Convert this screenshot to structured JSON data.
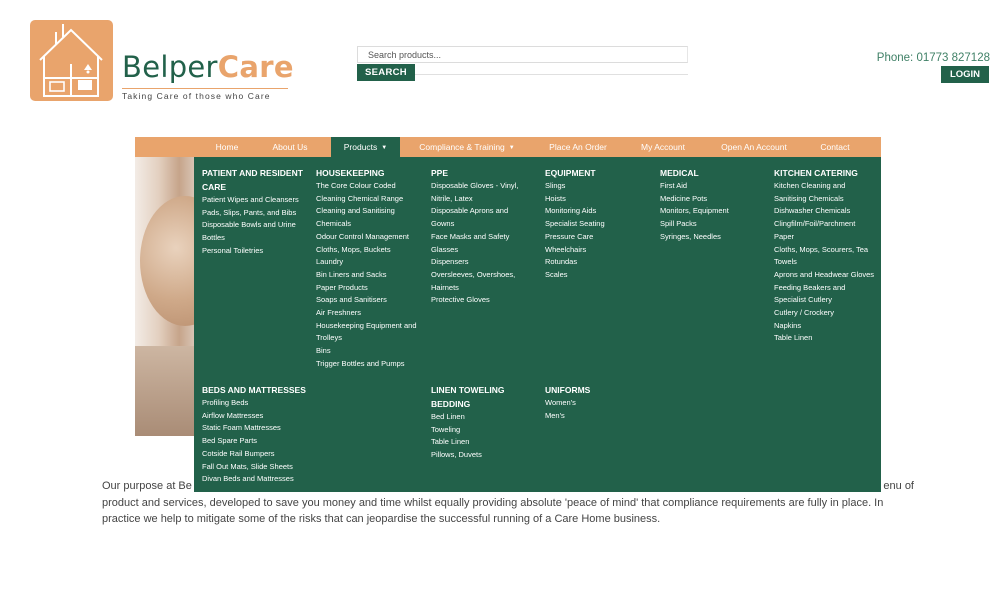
{
  "brand": {
    "name_part1": "Belper",
    "name_part2": "Care",
    "tagline": "Taking Care of those who Care"
  },
  "search": {
    "placeholder": "Search products...",
    "button": "SEARCH"
  },
  "header": {
    "phone": "Phone: 01773 827128",
    "login": "LOGIN"
  },
  "nav": {
    "items": [
      "Home",
      "About Us",
      "Products",
      "Compliance & Training",
      "Place An Order",
      "My Account",
      "Open An Account",
      "Contact"
    ],
    "active": "Products"
  },
  "menu": {
    "patient": {
      "title": "PATIENT AND RESIDENT CARE",
      "items": [
        "Patient Wipes and Cleansers",
        "Pads, Slips, Pants, and Bibs",
        "Disposable Bowls and Urine Bottles",
        "Personal Toiletries"
      ]
    },
    "housekeeping": {
      "title": "HOUSEKEEPING",
      "items": [
        "The Core Colour Coded Cleaning Chemical Range",
        "Cleaning and Sanitising Chemicals",
        "Odour Control Management",
        "Cloths, Mops, Buckets",
        "Laundry",
        "Bin Liners and Sacks",
        "Paper Products",
        "Soaps and Sanitisers",
        "Air Freshners",
        "Housekeeping Equipment and Trolleys",
        "Bins",
        "Trigger Bottles and Pumps"
      ]
    },
    "ppe": {
      "title": "PPE",
      "items": [
        "Disposable Gloves - Vinyl, Nitrile, Latex",
        "Disposable Aprons and Gowns",
        "Face Masks and Safety Glasses",
        "Dispensers",
        "Oversleeves, Overshoes, Hairnets",
        "Protective Gloves"
      ]
    },
    "equipment": {
      "title": "EQUIPMENT",
      "items": [
        "Slings",
        "Hoists",
        "Monitoring Aids",
        "Specialist Seating",
        "Pressure Care",
        "Wheelchairs",
        "Rotundas",
        "Scales"
      ]
    },
    "medical": {
      "title": "MEDICAL",
      "items": [
        "First Aid",
        "Medicine Pots",
        "Monitors, Equipment",
        "Spill Packs",
        "Syringes, Needles"
      ]
    },
    "kitchen": {
      "title": "KITCHEN CATERING",
      "items": [
        "Kitchen Cleaning and Sanitising Chemicals",
        "Dishwasher Chemicals",
        "Clingfilm/Foil/Parchment Paper",
        "Cloths, Mops, Scourers, Tea Towels",
        "Aprons and Headwear Gloves",
        "Feeding Beakers and Specialist Cutlery",
        "Cutlery / Crockery",
        "Napkins",
        "Table Linen"
      ]
    },
    "beds": {
      "title": "BEDS AND MATTRESSES",
      "items": [
        "Profiling Beds",
        "Airflow Mattresses",
        "Static Foam Mattresses",
        "Bed Spare Parts",
        "Cotside Rail Bumpers",
        "Fall Out Mats, Slide Sheets",
        "Divan Beds and Mattresses"
      ]
    },
    "linen": {
      "title": "LINEN TOWELING BEDDING",
      "items": [
        "Bed Linen",
        "Toweling",
        "Table Linen",
        "Pillows, Duvets"
      ]
    },
    "uniforms": {
      "title": "UNIFORMS",
      "items": [
        "Women's",
        "Men's"
      ]
    }
  },
  "content": {
    "para_start": "Our purpose at Be",
    "para_end": "enu of",
    "para_rest": "product and services, developed to save you money and time whilst equally providing absolute 'peace of mind' that compliance requirements are fully in place. In practice we help to mitigate some of the risks that can jeopardise the successful running of a Care Home business."
  },
  "colors": {
    "green": "#22614a",
    "orange": "#e9a46c"
  }
}
